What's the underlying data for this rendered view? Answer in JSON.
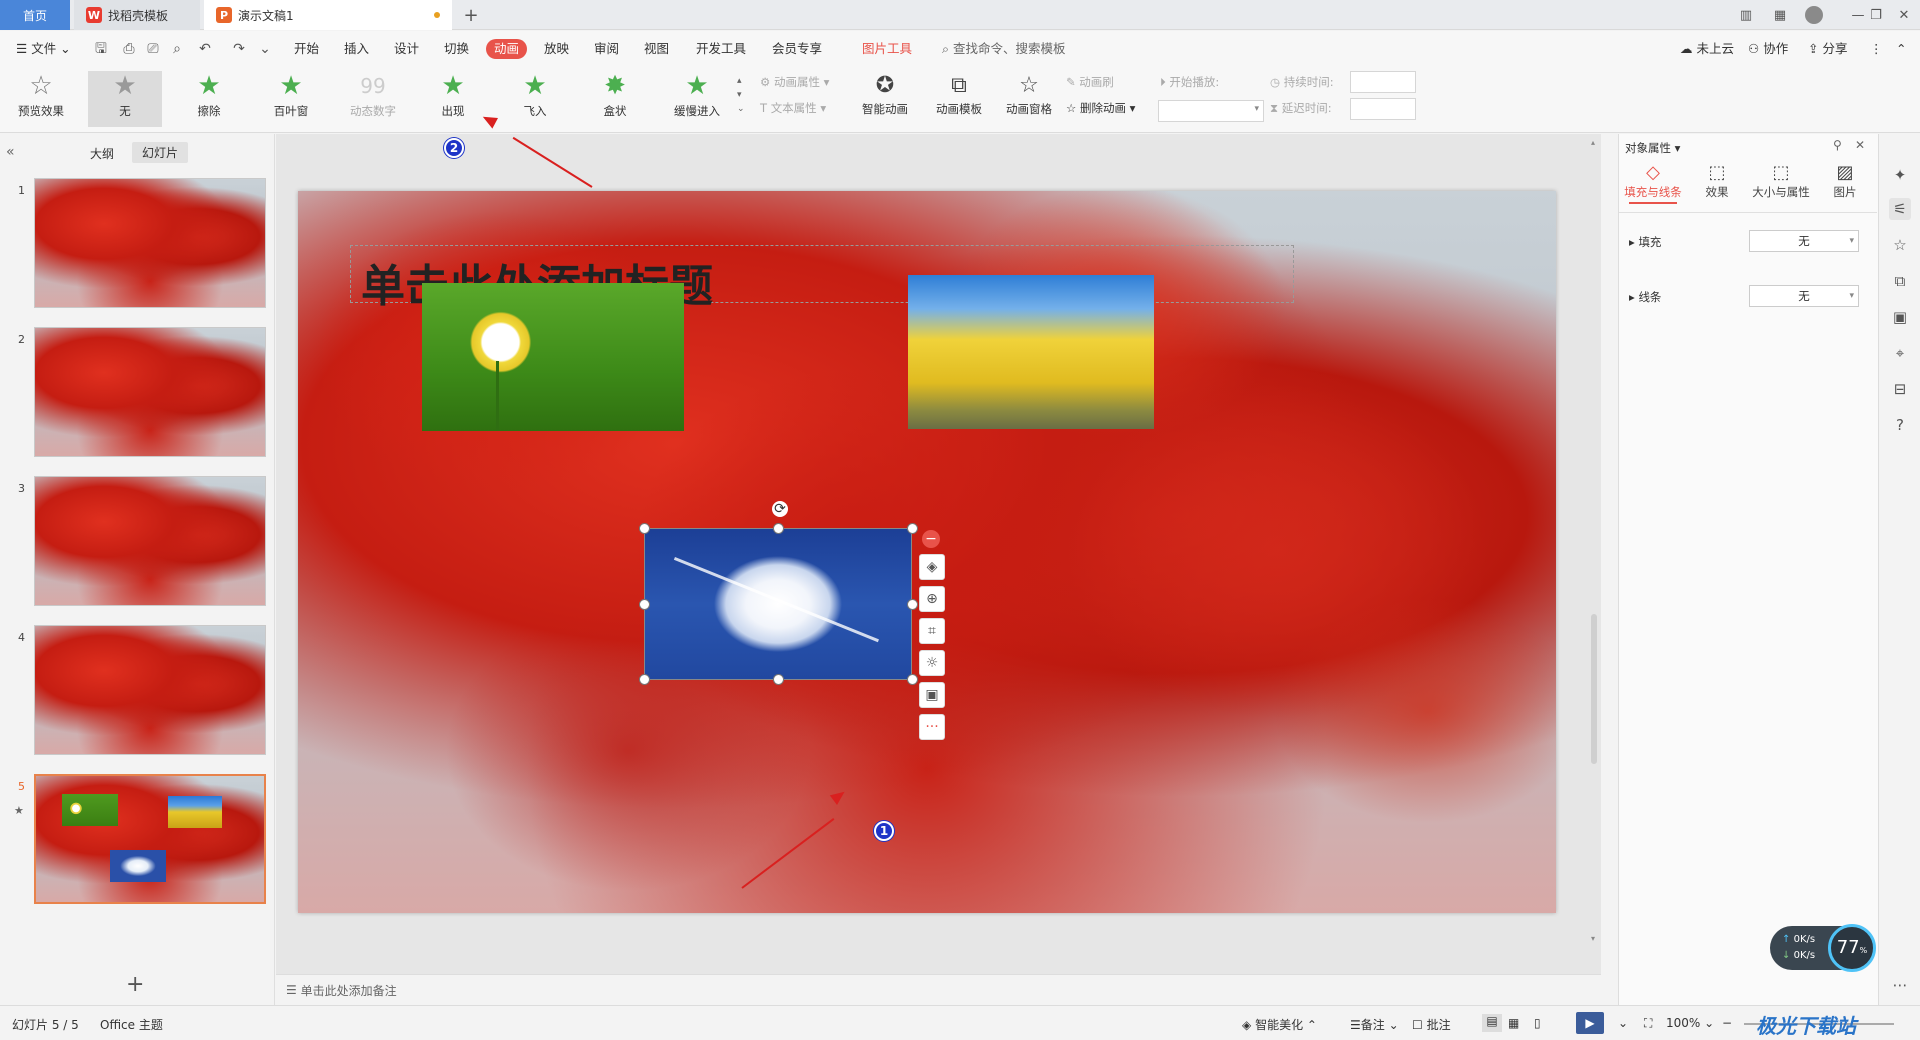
{
  "tabs": {
    "home": "首页",
    "templates": "找稻壳模板",
    "document": "演示文稿1",
    "add": "+"
  },
  "menu": {
    "file": "文件",
    "items": [
      "开始",
      "插入",
      "设计",
      "切换",
      "动画",
      "放映",
      "审阅",
      "视图",
      "开发工具",
      "会员专享"
    ],
    "active": "动画",
    "picture_tools": "图片工具",
    "search": "查找命令、搜索模板",
    "cloud": "未上云",
    "collab": "协作",
    "share": "分享"
  },
  "ribbon": {
    "preview": "预览效果",
    "effects": [
      "无",
      "擦除",
      "百叶窗",
      "动态数字",
      "出现",
      "飞入",
      "盒状",
      "缓慢进入"
    ],
    "anim_props": "动画属性",
    "text_props": "文本属性",
    "smart": "智能动画",
    "template": "动画模板",
    "pane": "动画窗格",
    "brush": "动画刷",
    "delete": "删除动画",
    "start": "开始播放:",
    "duration": "持续时间:",
    "delay": "延迟时间:"
  },
  "leftpanel": {
    "outline": "大纲",
    "slides": "幻灯片",
    "numbers": [
      "1",
      "2",
      "3",
      "4",
      "5"
    ],
    "add": "+"
  },
  "slide": {
    "title_placeholder": "单击此处添加标题"
  },
  "notes": "单击此处添加备注",
  "annotations": [
    "1",
    "2"
  ],
  "props": {
    "title": "对象属性",
    "tabs": [
      "填充与线条",
      "效果",
      "大小与属性",
      "图片"
    ],
    "fill": "填充",
    "fill_value": "无",
    "line": "线条",
    "line_value": "无"
  },
  "status": {
    "slide": "幻灯片 5 / 5",
    "theme": "Office 主题",
    "beautify": "智能美化",
    "notes": "备注",
    "comments": "批注",
    "zoom": "100%"
  },
  "netmeter": {
    "up": "0K/s",
    "down": "0K/s",
    "cpu": "77"
  },
  "watermark": "极光下载站"
}
